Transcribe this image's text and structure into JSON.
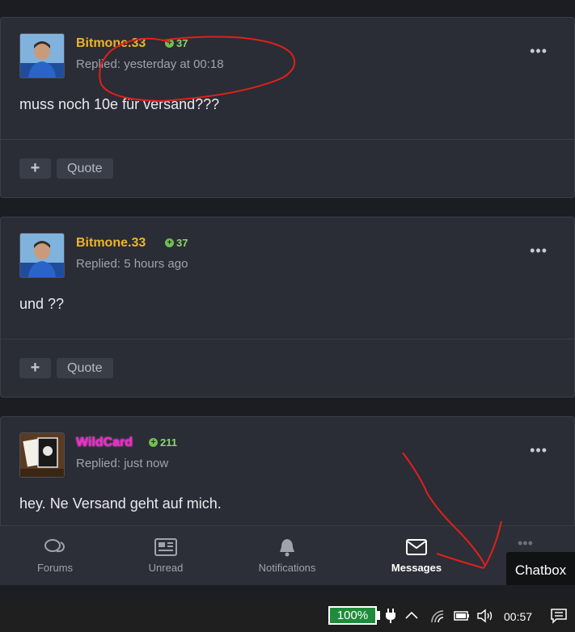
{
  "posts": [
    {
      "author": "Bitmone.33",
      "reputation": "37",
      "meta": "Replied: yesterday at 00:18",
      "content": "muss noch 10e für versand???",
      "more": "•••",
      "plus_label": "+",
      "quote_label": "Quote"
    },
    {
      "author": "Bitmone.33",
      "reputation": "37",
      "meta": "Replied: 5 hours ago",
      "content": "und ??",
      "more": "•••",
      "plus_label": "+",
      "quote_label": "Quote"
    },
    {
      "author": "WildCard",
      "reputation": "211",
      "meta": "Replied: just now",
      "content": "hey. Ne Versand geht auf mich.",
      "more": "•••"
    }
  ],
  "bottom_nav": {
    "items": [
      {
        "label": "Forums",
        "icon": "forums-icon"
      },
      {
        "label": "Unread",
        "icon": "newspaper-icon"
      },
      {
        "label": "Notifications",
        "icon": "bell-icon"
      },
      {
        "label": "Messages",
        "icon": "envelope-icon",
        "active": true
      }
    ],
    "more": "•••",
    "chatbox": "Chatbox"
  },
  "taskbar": {
    "battery": "100%",
    "clock": "00:57"
  },
  "colors": {
    "author_gold": "#f0b429",
    "author_pink": "#ff21d4",
    "reputation_green": "#8ed46a",
    "annotation_red": "#e0201b"
  }
}
